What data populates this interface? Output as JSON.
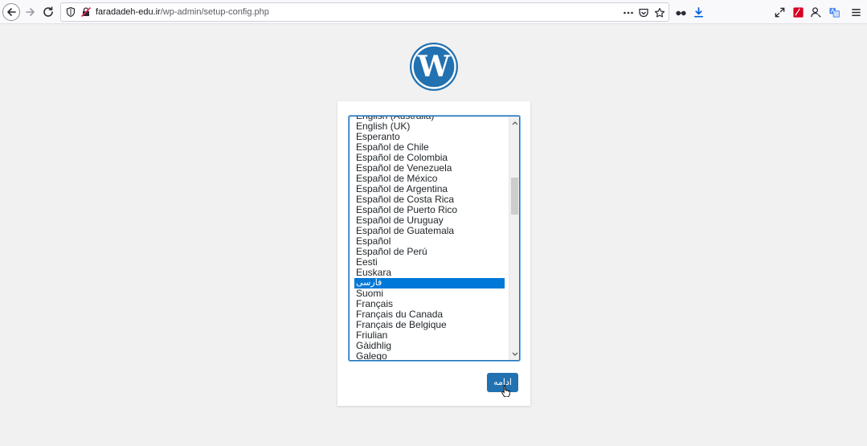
{
  "browser": {
    "url_domain": "faradadeh-edu.ir",
    "url_path": "/wp-admin/setup-config.php",
    "page_actions_icon": "more-dots-icon"
  },
  "colors": {
    "wp_blue": "#2271b1",
    "selection_blue": "#0078d7",
    "page_bg": "#f1f1f1"
  },
  "language_select": {
    "visible_options": [
      "English (Australia)",
      "English (UK)",
      "Esperanto",
      "Español de Chile",
      "Español de Colombia",
      "Español de Venezuela",
      "Español de México",
      "Español de Argentina",
      "Español de Costa Rica",
      "Español de Puerto Rico",
      "Español de Uruguay",
      "Español de Guatemala",
      "Español",
      "Español de Perú",
      "Eesti",
      "Euskara",
      "فارسی",
      "Suomi",
      "Français",
      "Français du Canada",
      "Français de Belgique",
      "Friulian",
      "Gàidhlig",
      "Galego"
    ],
    "selected": "فارسی"
  },
  "continue_button": {
    "label": "ادامه"
  }
}
